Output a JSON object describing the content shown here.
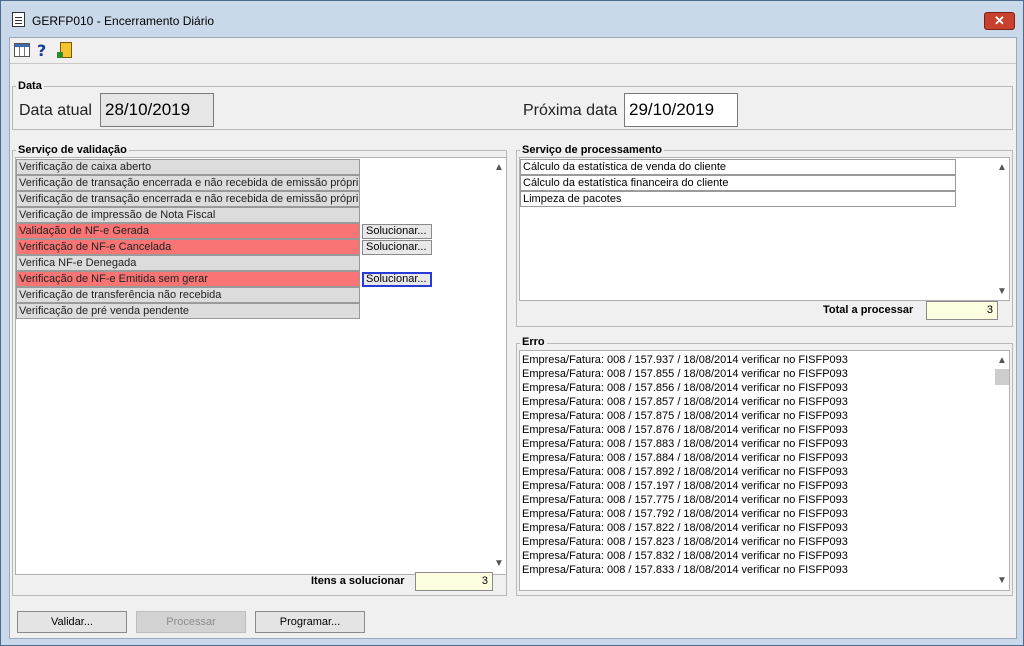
{
  "window": {
    "title": "GERFP010 - Encerramento Diário",
    "close": "✕"
  },
  "toolbar": {
    "help": "?"
  },
  "data_section": {
    "label": "Data",
    "current_label": "Data atual",
    "current_value": "28/10/2019",
    "next_label": "Próxima data",
    "next_value": "29/10/2019"
  },
  "validation": {
    "label": "Serviço de validação",
    "items": [
      {
        "text": "Verificação de caixa aberto"
      },
      {
        "text": "Verificação de transação encerrada e não recebida de emissão própri"
      },
      {
        "text": "Verificação de transação encerrada e não recebida de emissão própri"
      },
      {
        "text": "Verificação de impressão de Nota Fiscal"
      },
      {
        "text": "Validação de NF-e Gerada",
        "button": "Solucionar..."
      },
      {
        "text": "Verificação de NF-e Cancelada",
        "button": "Solucionar..."
      },
      {
        "text": "Verifica NF-e Denegada"
      },
      {
        "text": "Verificação de NF-e Emitida sem gerar",
        "button": "Solucionar..."
      },
      {
        "text": "Verificação de transferência não recebida"
      },
      {
        "text": "Verificação de pré venda pendente"
      }
    ],
    "count_label": "Itens a solucionar",
    "count_value": "3"
  },
  "processing": {
    "label": "Serviço de processamento",
    "items": [
      "Cálculo da estatística de venda do cliente",
      "Cálculo da estatística financeira do cliente",
      "Limpeza de pacotes"
    ],
    "count_label": "Total a processar",
    "count_value": "3"
  },
  "error": {
    "label": "Erro",
    "lines": [
      "Empresa/Fatura: 008 / 157.937 / 18/08/2014 verificar no FISFP093",
      "Empresa/Fatura: 008 / 157.855 / 18/08/2014 verificar no FISFP093",
      "Empresa/Fatura: 008 / 157.856 / 18/08/2014 verificar no FISFP093",
      "Empresa/Fatura: 008 / 157.857 / 18/08/2014 verificar no FISFP093",
      "Empresa/Fatura: 008 / 157.875 / 18/08/2014 verificar no FISFP093",
      "Empresa/Fatura: 008 / 157.876 / 18/08/2014 verificar no FISFP093",
      "Empresa/Fatura: 008 / 157.883 / 18/08/2014 verificar no FISFP093",
      "Empresa/Fatura: 008 / 157.884 / 18/08/2014 verificar no FISFP093",
      "Empresa/Fatura: 008 / 157.892 / 18/08/2014 verificar no FISFP093",
      "Empresa/Fatura: 008 / 157.197 / 18/08/2014 verificar no FISFP093",
      "Empresa/Fatura: 008 / 157.775 / 18/08/2014 verificar no FISFP093",
      "Empresa/Fatura: 008 / 157.792 / 18/08/2014 verificar no FISFP093",
      "Empresa/Fatura: 008 / 157.822 / 18/08/2014 verificar no FISFP093",
      "Empresa/Fatura: 008 / 157.823 / 18/08/2014 verificar no FISFP093",
      "Empresa/Fatura: 008 / 157.832 / 18/08/2014 verificar no FISFP093",
      "Empresa/Fatura: 008 / 157.833 / 18/08/2014 verificar no FISFP093"
    ]
  },
  "buttons": {
    "validate": "Validar...",
    "process": "Processar",
    "schedule": "Programar..."
  },
  "scroll": {
    "up": "▲",
    "down": "▼"
  }
}
